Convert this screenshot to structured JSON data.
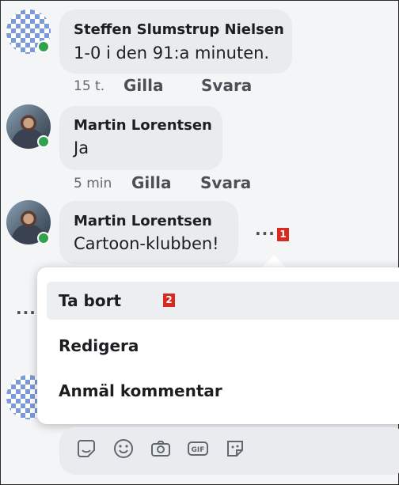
{
  "comments": [
    {
      "author": "Steffen Slumstrup Nielsen",
      "text": "1-0 i den 91:a minuten.",
      "time": "15 t.",
      "like_label": "Gilla",
      "reply_label": "Svara"
    },
    {
      "author": "Martin Lorentsen",
      "text": "Ja",
      "time": "5 min",
      "like_label": "Gilla",
      "reply_label": "Svara"
    },
    {
      "author": "Martin Lorentsen",
      "text": "Cartoon-klubben!"
    }
  ],
  "more_options": {
    "label": "···",
    "badge": "1"
  },
  "context_menu": {
    "items": [
      {
        "label": "Ta bort",
        "badge": "2"
      },
      {
        "label": "Redigera"
      },
      {
        "label": "Anmäl kommentar"
      }
    ]
  },
  "reply_toolbar": {
    "icons": [
      "sticker-icon",
      "emoji-icon",
      "camera-icon",
      "gif-icon",
      "sticker-note-icon"
    ],
    "gif_text": "GIF"
  },
  "colors": {
    "online": "#31a24c",
    "badge": "#d92a1f",
    "bubble": "#e9ebee"
  }
}
